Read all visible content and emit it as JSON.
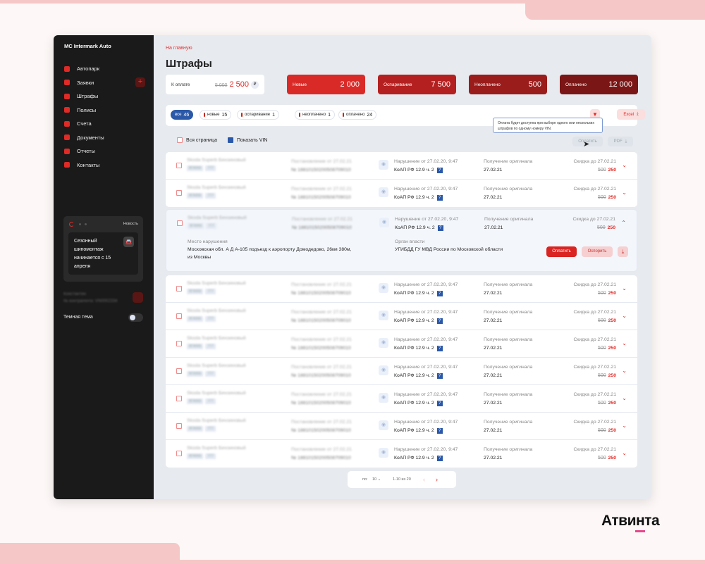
{
  "app": {
    "brand": "MC Intermark Auto"
  },
  "sidebar": {
    "items": [
      {
        "label": "Автопарк"
      },
      {
        "label": "Заявки"
      },
      {
        "label": "Штрафы"
      },
      {
        "label": "Полисы"
      },
      {
        "label": "Счета"
      },
      {
        "label": "Документы"
      },
      {
        "label": "Отчеты"
      },
      {
        "label": "Контакты"
      }
    ],
    "news": {
      "label": "Новость",
      "text": "Сезонный шиномонтаж начинается с 15 апреля"
    },
    "user": {
      "name": "Константин",
      "contract": "№ контрагента: VN0002334"
    },
    "theme_label": "Темная тема"
  },
  "header": {
    "breadcrumb": "На главную",
    "title": "Штрафы"
  },
  "summary": {
    "to_pay": {
      "label": "К оплате",
      "old": "5 000",
      "value": "2 500",
      "currency": "₽"
    },
    "cards": [
      {
        "label": "Новые",
        "value": "2 000",
        "color": "#d92a27"
      },
      {
        "label": "Оспаривание",
        "value": "7 500",
        "color": "#b42020"
      },
      {
        "label": "Неоплачено",
        "value": "500",
        "color": "#9a1c1b"
      },
      {
        "label": "Оплачено",
        "value": "12 000",
        "color": "#7a1716"
      }
    ]
  },
  "filters": [
    {
      "label": "все",
      "count": "46"
    },
    {
      "label": "новые",
      "count": "15"
    },
    {
      "label": "оспаривание",
      "count": "1"
    },
    {
      "label": "неоплачено",
      "count": "1"
    },
    {
      "label": "оплачено",
      "count": "24"
    }
  ],
  "excel_label": "Excel",
  "tooltip": "Оплата будет доступна при выборе одного или нескольких штрафов по одному номеру VIN.",
  "toolbar": {
    "select_page": "Вся страница",
    "show_vin": "Показать VIN",
    "pay": "Оплатить",
    "pdf": "PDF"
  },
  "fine": {
    "car": "Skoda Superb Бензиновый",
    "tag1": "ВГА966",
    "tag2": "777",
    "decree": "Постановление от 27.02.21",
    "number": "№ 18810150200508709010",
    "violation": "Нарушение от 27.02.20, 9:47",
    "article": "КоАП РФ 12.9 ч. 2",
    "q": "?",
    "orig_label": "Получение оригинала",
    "orig_date": "27.02.21",
    "discount": "Скидка до 27.02.21",
    "old": "500",
    "new": "250"
  },
  "expanded": {
    "place_label": "Место нарушения",
    "place": "Московская обл. А Д А-105 подъезд к аэропорту Домодедово, 26км 380м, из Москвы",
    "authority_label": "Орган власти",
    "authority": "УГИБДД ГУ МВД России по Московской области",
    "pay": "Оплатить",
    "dispute": "Оспорить"
  },
  "pager": {
    "per_label": "по:",
    "per": "10",
    "range": "1-10 из 20"
  },
  "logo": "Атвинта"
}
